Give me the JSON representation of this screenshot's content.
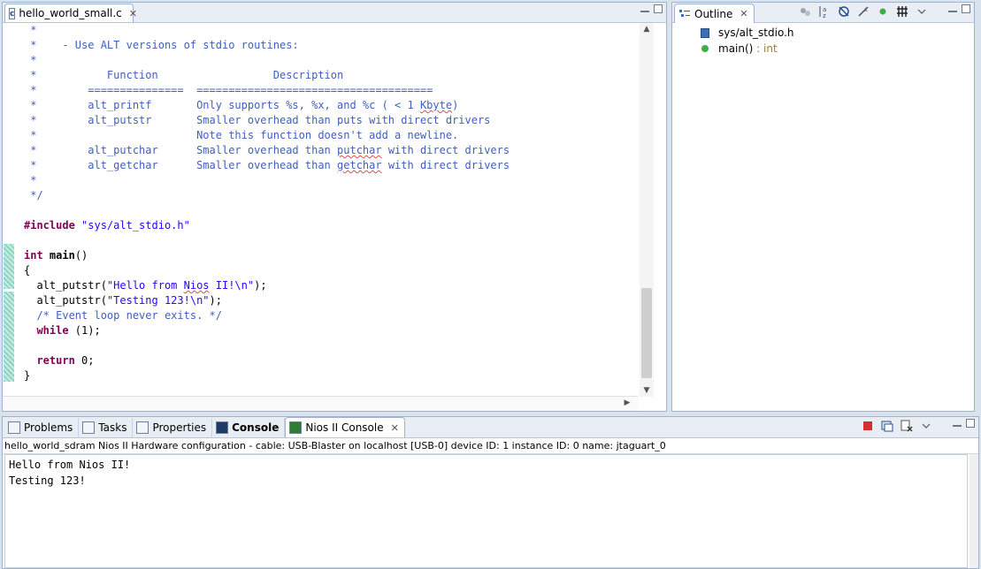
{
  "editor": {
    "tab_label": "hello_world_small.c",
    "tab_icon_letter": "c",
    "code_lines": [
      [
        {
          "t": " *",
          "c": "c-comment"
        }
      ],
      [
        {
          "t": " *    - Use ALT versions of stdio routines:",
          "c": "c-comment"
        }
      ],
      [
        {
          "t": " *",
          "c": "c-comment"
        }
      ],
      [
        {
          "t": " *           Function                  Description",
          "c": "c-comment"
        }
      ],
      [
        {
          "t": " *        ===============  =====================================",
          "c": "c-comment"
        }
      ],
      [
        {
          "t": " *        alt_printf       Only supports %s, %x, and %c ( < 1 ",
          "c": "c-comment"
        },
        {
          "t": "Kbyte",
          "c": "c-comment squig"
        },
        {
          "t": ")",
          "c": "c-comment"
        }
      ],
      [
        {
          "t": " *        alt_putstr       Smaller overhead than puts with direct drivers",
          "c": "c-comment"
        }
      ],
      [
        {
          "t": " *                         Note this function doesn't add a newline.",
          "c": "c-comment"
        }
      ],
      [
        {
          "t": " *        alt_putchar      Smaller overhead than ",
          "c": "c-comment"
        },
        {
          "t": "putchar",
          "c": "c-comment squig"
        },
        {
          "t": " with direct drivers",
          "c": "c-comment"
        }
      ],
      [
        {
          "t": " *        alt_getchar      Smaller overhead than ",
          "c": "c-comment"
        },
        {
          "t": "getchar",
          "c": "c-comment squig"
        },
        {
          "t": " with direct drivers",
          "c": "c-comment"
        }
      ],
      [
        {
          "t": " *",
          "c": "c-comment"
        }
      ],
      [
        {
          "t": " */",
          "c": "c-comment"
        }
      ],
      [
        {
          "t": "",
          "c": "c-plain"
        }
      ],
      [
        {
          "t": "#include ",
          "c": "c-pre"
        },
        {
          "t": "\"sys/alt_stdio.h\"",
          "c": "c-str"
        }
      ],
      [
        {
          "t": "",
          "c": "c-plain"
        }
      ],
      [
        {
          "t": "int",
          "c": "c-kw"
        },
        {
          "t": " ",
          "c": "c-plain"
        },
        {
          "t": "main",
          "c": "c-plain b"
        },
        {
          "t": "()",
          "c": "c-plain"
        }
      ],
      [
        {
          "t": "{",
          "c": "c-plain"
        }
      ],
      [
        {
          "t": "  alt_putstr(",
          "c": "c-plain"
        },
        {
          "t": "\"Hello from ",
          "c": "c-str"
        },
        {
          "t": "Nios",
          "c": "c-str squig"
        },
        {
          "t": " II!\\n\"",
          "c": "c-str"
        },
        {
          "t": ");",
          "c": "c-plain"
        }
      ],
      [
        {
          "t": "  alt_putstr(",
          "c": "c-plain"
        },
        {
          "t": "\"Testing 123!\\n\"",
          "c": "c-str"
        },
        {
          "t": ");",
          "c": "c-plain"
        }
      ],
      [
        {
          "t": "  /* Event loop never exits. */",
          "c": "c-comment"
        }
      ],
      [
        {
          "t": "  ",
          "c": "c-plain"
        },
        {
          "t": "while",
          "c": "c-kw"
        },
        {
          "t": " (1);",
          "c": "c-plain"
        }
      ],
      [
        {
          "t": "",
          "c": "c-plain"
        }
      ],
      [
        {
          "t": "  ",
          "c": "c-plain"
        },
        {
          "t": "return",
          "c": "c-kw"
        },
        {
          "t": " 0;",
          "c": "c-plain"
        }
      ],
      [
        {
          "t": "}",
          "c": "c-plain"
        }
      ]
    ]
  },
  "outline": {
    "tab_label": "Outline",
    "items": [
      {
        "label": "sys/alt_stdio.h",
        "icon": "header-file-icon"
      },
      {
        "label": "main()",
        "suffix": " : int",
        "icon": "function-icon"
      }
    ],
    "tool_icons": [
      "hide-fields-icon",
      "sort-alphabetically-icon",
      "hide-static-icon",
      "hide-non-public-icon",
      "green-dot-icon",
      "group-icon"
    ]
  },
  "bottom": {
    "tabs": [
      {
        "label": "Problems",
        "icon": "problems-icon"
      },
      {
        "label": "Tasks",
        "icon": "tasks-icon"
      },
      {
        "label": "Properties",
        "icon": "properties-icon"
      },
      {
        "label": "Console",
        "icon": "console-icon",
        "bold": true
      },
      {
        "label": "Nios II Console",
        "icon": "nios-console-icon",
        "active": true
      }
    ],
    "console_description": "hello_world_sdram Nios II Hardware configuration - cable: USB-Blaster on localhost [USB-0] device ID: 1 instance ID: 0 name: jtaguart_0",
    "console_output": "Hello from Nios II!\nTesting 123!",
    "tool_icons": [
      "terminate-icon",
      "display-console-icon",
      "remove-launch-icon"
    ]
  },
  "colors": {
    "accent": "#9db3cf",
    "comment": "#3f5fbf",
    "keyword": "#7f0055",
    "string": "#2a00ff"
  }
}
